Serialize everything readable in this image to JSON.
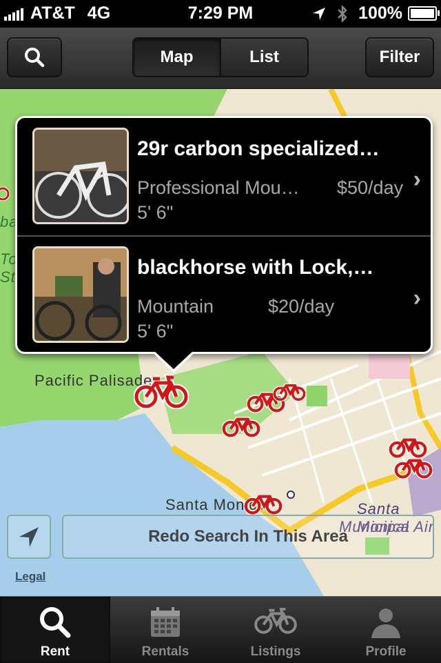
{
  "status_bar": {
    "carrier": "AT&T",
    "network": "4G",
    "time": "7:29 PM",
    "battery": "100%",
    "icons": [
      "signal-icon",
      "location-arrow-icon",
      "bluetooth-icon",
      "battery-icon"
    ]
  },
  "nav": {
    "search_icon": "search-icon",
    "segments": [
      {
        "label": "Map",
        "selected": true
      },
      {
        "label": "List",
        "selected": false
      }
    ],
    "filter_label": "Filter"
  },
  "map": {
    "labels": [
      "Pacific Palisades",
      "Santa Monica",
      "Santa Monica",
      "Municipal Airport",
      "Topanga State Park"
    ],
    "visible_label_text": {
      "pacific": "Pacific Palisades",
      "santa_monica": "Santa Monica",
      "airport_1": "Santa Monica",
      "airport_2": "Municipal Air",
      "left_1": "To",
      "left_2": "Sta",
      "left_3": "ba"
    },
    "marker_icon": "bike-marker-icon",
    "marker_color": "#d01818"
  },
  "callout": {
    "listings": [
      {
        "title": "29r carbon specialized…",
        "type": "Professional Mou…",
        "price": "$50/day",
        "size": "5' 6\""
      },
      {
        "title": "blackhorse with Lock,…",
        "type": "Mountain",
        "price": "$20/day",
        "size": "5' 6\""
      }
    ]
  },
  "controls": {
    "redo_search": "Redo Search In This Area",
    "legal": "Legal"
  },
  "tabbar": {
    "tabs": [
      {
        "label": "Rent",
        "icon": "search-icon",
        "active": true
      },
      {
        "label": "Rentals",
        "icon": "calendar-icon",
        "active": false
      },
      {
        "label": "Listings",
        "icon": "bike-icon",
        "active": false
      },
      {
        "label": "Profile",
        "icon": "person-icon",
        "active": false
      }
    ]
  },
  "colors": {
    "map_land": "#efe7d2",
    "map_water": "#a6cde9",
    "map_park": "#8ed46b",
    "road": "#f5c928",
    "marker": "#d01818"
  }
}
